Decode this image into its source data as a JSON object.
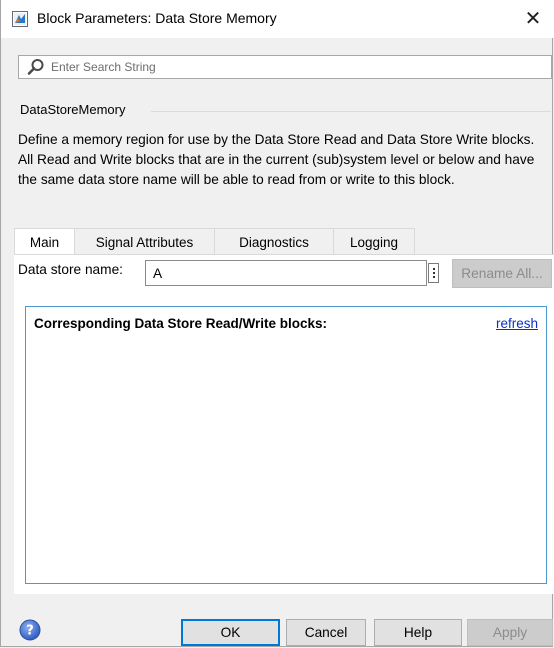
{
  "window": {
    "title": "Block Parameters: Data Store Memory",
    "close_glyph": "✕"
  },
  "search": {
    "placeholder": "Enter Search String",
    "value": ""
  },
  "block": {
    "type_label": "DataStoreMemory",
    "description": "Define a memory region for use by the Data Store Read and Data Store Write blocks. All Read and Write blocks that are in the current (sub)system level or below and have the same data store name will be able to read from or write to this block."
  },
  "tabs": [
    {
      "label": "Main",
      "active": true
    },
    {
      "label": "Signal Attributes",
      "active": false
    },
    {
      "label": "Diagnostics",
      "active": false
    },
    {
      "label": "Logging",
      "active": false
    }
  ],
  "main": {
    "data_store_name_label": "Data store name:",
    "data_store_name_value": "A",
    "rename_all_label": "Rename All...",
    "corresponding_title": "Corresponding Data Store Read/Write blocks:",
    "refresh_label": "refresh"
  },
  "buttons": {
    "ok": "OK",
    "cancel": "Cancel",
    "help": "Help",
    "apply": "Apply"
  },
  "icons": {
    "app": "simulink-block-icon",
    "search": "search-icon",
    "help": "help-icon",
    "menu": "vertical-dots-icon"
  },
  "colors": {
    "accent": "#0078d7",
    "link": "#0a31c4",
    "panel_border": "#4a9ad1",
    "disabled_bg": "#cccccc"
  }
}
